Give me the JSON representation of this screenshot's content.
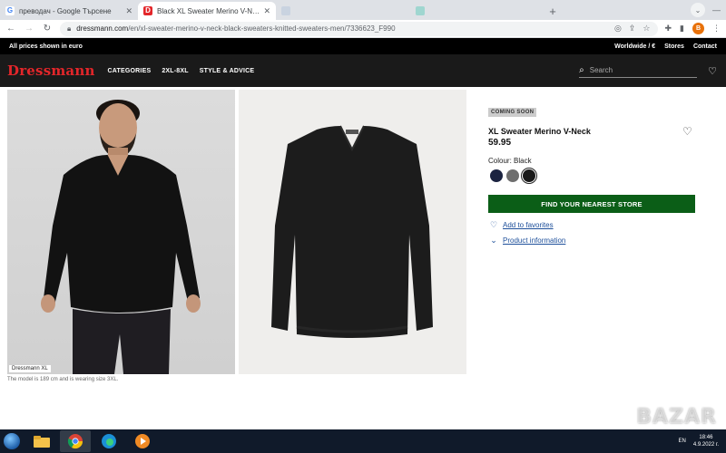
{
  "browser": {
    "tabs": [
      {
        "title": "преводач - Google Търсене",
        "favicon": "G",
        "active": false
      },
      {
        "title": "Black XL Sweater Merino V-Neck",
        "favicon": "D",
        "active": true
      },
      {
        "title": "",
        "favicon": "",
        "active": false
      },
      {
        "title": "",
        "favicon": "",
        "active": false
      }
    ],
    "url_host": "dressmann.com",
    "url_path": "/en/xl-sweater-merino-v-neck-black-sweaters-knitted-sweaters-men/7336623_F990",
    "profile_initial": "B"
  },
  "site_top": {
    "left": "All prices shown in euro",
    "worldwide": "Worldwide / €",
    "stores": "Stores",
    "contact": "Contact"
  },
  "nav": {
    "logo": "Dressmann",
    "links": [
      "CATEGORIES",
      "2XL-8XL",
      "STYLE & ADVICE"
    ],
    "search_placeholder": "Search"
  },
  "gallery": {
    "badge": "Dressmann XL",
    "caption": "The model is 189 cm and is wearing size 3XL."
  },
  "product": {
    "status": "COMING SOON",
    "name": "XL Sweater Merino V-Neck",
    "price": "59.95",
    "colour_label": "Colour: Black",
    "swatches": [
      "#1b2340",
      "#6e6e6e",
      "#1a1a1a"
    ],
    "selected_swatch": 2,
    "store_button": "FIND YOUR NEAREST STORE",
    "favorites_link": "Add to favorites",
    "info_link": "Product information"
  },
  "taskbar": {
    "lang": "EN",
    "time": "18:46",
    "date": "4.9.2022 г."
  },
  "watermark": "BAZAR"
}
